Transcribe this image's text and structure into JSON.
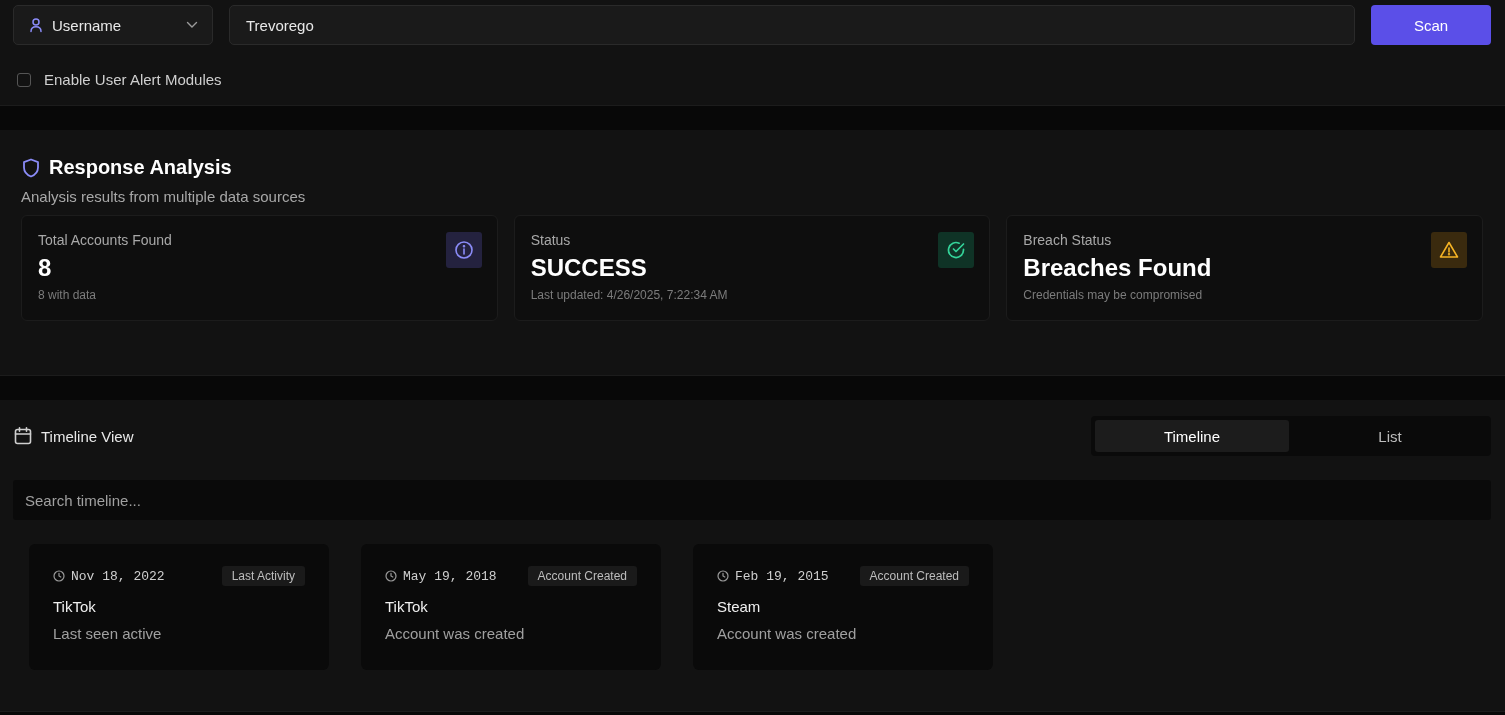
{
  "search_bar": {
    "type_select": {
      "label": "Username"
    },
    "query": {
      "value": "Trevorego"
    },
    "scan_button": "Scan",
    "alert_modules": {
      "label": "Enable User Alert Modules",
      "checked": false
    }
  },
  "analysis": {
    "title": "Response Analysis",
    "subtitle": "Analysis results from multiple data sources",
    "stats": [
      {
        "label": "Total Accounts Found",
        "value": "8",
        "note": "8 with data",
        "kind": "info"
      },
      {
        "label": "Status",
        "value": "SUCCESS",
        "note": "Last updated: 4/26/2025, 7:22:34 AM",
        "kind": "success"
      },
      {
        "label": "Breach Status",
        "value": "Breaches Found",
        "note": "Credentials may be compromised",
        "kind": "warning"
      }
    ]
  },
  "timeline": {
    "title": "Timeline View",
    "tabs": [
      {
        "label": "Timeline",
        "selected": true
      },
      {
        "label": "List",
        "selected": false
      }
    ],
    "search": {
      "placeholder": "Search timeline..."
    },
    "events": [
      {
        "date": "Nov 18, 2022",
        "tag": "Last Activity",
        "platform": "TikTok",
        "description": "Last seen active"
      },
      {
        "date": "May 19, 2018",
        "tag": "Account Created",
        "platform": "TikTok",
        "description": "Account was created"
      },
      {
        "date": "Feb 19, 2015",
        "tag": "Account Created",
        "platform": "Steam",
        "description": "Account was created"
      }
    ]
  }
}
